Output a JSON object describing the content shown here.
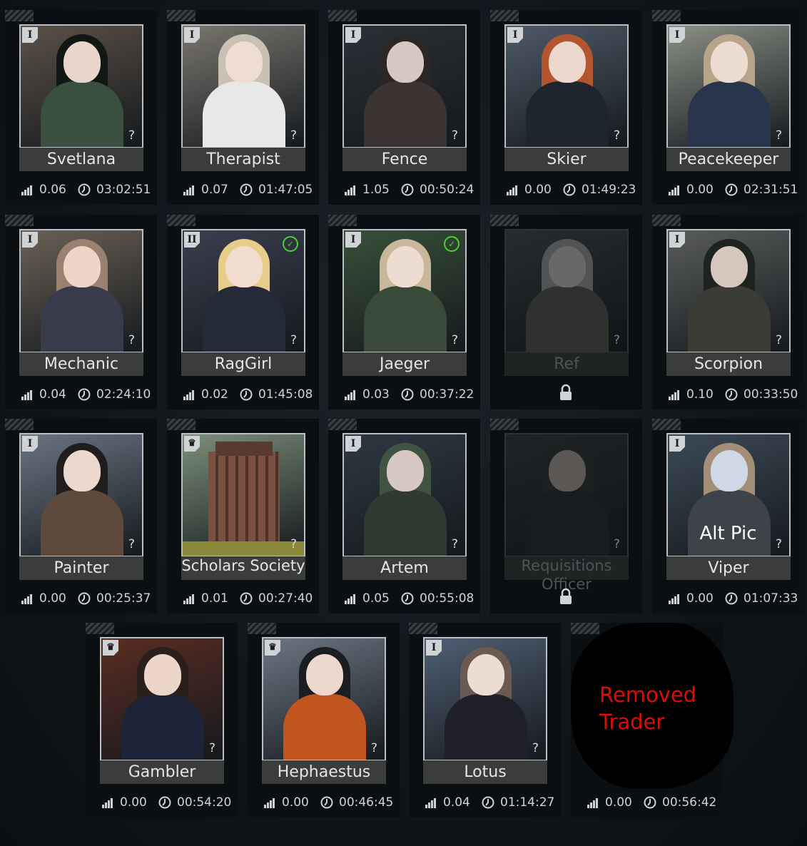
{
  "traders": [
    {
      "name": "Svetlana",
      "rank": "I",
      "rating": "0.06",
      "timer": "03:02:51",
      "theme": {
        "bg": "#5b5148",
        "hair": "#121614",
        "body": "#39503f",
        "skin": "#e8d6cc"
      },
      "locked": false,
      "checked": false
    },
    {
      "name": "Therapist",
      "rank": "I",
      "rating": "0.07",
      "timer": "01:47:05",
      "theme": {
        "bg": "#7a7670",
        "hair": "#c9c1b4",
        "body": "#e8e8e6",
        "skin": "#efdcd2"
      },
      "locked": false,
      "checked": false
    },
    {
      "name": "Fence",
      "rank": "I",
      "rating": "1.05",
      "timer": "00:50:24",
      "theme": {
        "bg": "#2a3036",
        "hair": "#2b2727",
        "body": "#3b3433",
        "skin": "#d8c8c2"
      },
      "locked": false,
      "checked": false
    },
    {
      "name": "Skier",
      "rank": "I",
      "rating": "0.00",
      "timer": "01:49:23",
      "theme": {
        "bg": "#4e5a68",
        "hair": "#b3552e",
        "body": "#1f252d",
        "skin": "#ecd8cd"
      },
      "locked": false,
      "checked": false
    },
    {
      "name": "Peacekeeper",
      "rank": "I",
      "rating": "0.00",
      "timer": "02:31:51",
      "theme": {
        "bg": "#8b8f86",
        "hair": "#b8a489",
        "body": "#28354d",
        "skin": "#ecdcd2"
      },
      "locked": false,
      "checked": false
    },
    {
      "name": "Mechanic",
      "rank": "I",
      "rating": "0.04",
      "timer": "02:24:10",
      "theme": {
        "bg": "#6a6156",
        "hair": "#9a8170",
        "body": "#373b4c",
        "skin": "#ecd6ca"
      },
      "locked": false,
      "checked": false
    },
    {
      "name": "RagGirl",
      "rank": "II",
      "rating": "0.02",
      "timer": "01:45:08",
      "theme": {
        "bg": "#3a3f4f",
        "hair": "#e8cc8a",
        "body": "#242a38",
        "skin": "#f1ddcf"
      },
      "locked": false,
      "checked": true
    },
    {
      "name": "Jaeger",
      "rank": "I",
      "rating": "0.03",
      "timer": "00:37:22",
      "theme": {
        "bg": "#39503a",
        "hair": "#c8b79b",
        "body": "#3a4a38",
        "skin": "#ecdcd2"
      },
      "locked": false,
      "checked": true
    },
    {
      "name": "Ref",
      "rank": "",
      "rating": "",
      "timer": "",
      "theme": {
        "bg": "#3e4448",
        "hair": "#8c8c8c",
        "body": "#4a4e44",
        "skin": "#b8b2ad"
      },
      "locked": true,
      "checked": false
    },
    {
      "name": "Scorpion",
      "rank": "I",
      "rating": "0.10",
      "timer": "00:33:50",
      "theme": {
        "bg": "#5a5c5b",
        "hair": "#1e2220",
        "body": "#3c3c36",
        "skin": "#d7c6bd"
      },
      "locked": false,
      "checked": false
    },
    {
      "name": "Painter",
      "rank": "I",
      "rating": "0.00",
      "timer": "00:25:37",
      "theme": {
        "bg": "#6a7583",
        "hair": "#1f1d1e",
        "body": "#5d4a3d",
        "skin": "#ecd8cd"
      },
      "locked": false,
      "checked": false
    },
    {
      "name": "Scholars Society",
      "rank": "crown",
      "rating": "0.01",
      "timer": "00:27:40",
      "theme": {
        "bg": "#7b8f7a",
        "hair": "",
        "body": "",
        "skin": ""
      },
      "locked": false,
      "checked": false,
      "scene": "building"
    },
    {
      "name": "Artem",
      "rank": "I",
      "rating": "0.05",
      "timer": "00:55:08",
      "theme": {
        "bg": "#2e3842",
        "hair": "#415444",
        "body": "#2f3a33",
        "skin": "#d8c8c2"
      },
      "locked": false,
      "checked": false
    },
    {
      "name": "Requisitions Officer",
      "rank": "",
      "rating": "",
      "timer": "",
      "theme": {
        "bg": "#30363d",
        "hair": "#2b2f2f",
        "body": "#22272a",
        "skin": "#9c948f"
      },
      "locked": true,
      "checked": false
    },
    {
      "name": "Viper",
      "rank": "I",
      "rating": "0.00",
      "timer": "01:07:33",
      "theme": {
        "bg": "#3c4a57",
        "hair": "#a38f77",
        "body": "#3d4348",
        "skin": "#cfd9e6"
      },
      "locked": false,
      "checked": false,
      "overlay": "Alt Pic"
    },
    {
      "name": "Gambler",
      "rank": "crown",
      "rating": "0.00",
      "timer": "00:54:20",
      "theme": {
        "bg": "#5a2c22",
        "hair": "#2a1f1b",
        "body": "#1e2437",
        "skin": "#ecd6ca"
      },
      "locked": false,
      "checked": false
    },
    {
      "name": "Hephaestus",
      "rank": "crown",
      "rating": "0.00",
      "timer": "00:46:45",
      "theme": {
        "bg": "#6c7684",
        "hair": "#1b1d21",
        "body": "#c2541f",
        "skin": "#ecd8cd"
      },
      "locked": false,
      "checked": false
    },
    {
      "name": "Lotus",
      "rank": "I",
      "rating": "0.04",
      "timer": "01:14:27",
      "theme": {
        "bg": "#4f5f73",
        "hair": "#6b5a52",
        "body": "#1f2029",
        "skin": "#ecdcd2"
      },
      "locked": false,
      "checked": false
    },
    {
      "name": "",
      "rank": "",
      "rating": "0.00",
      "timer": "00:56:42",
      "theme": {
        "bg": "#000000",
        "hair": "",
        "body": "",
        "skin": ""
      },
      "locked": false,
      "checked": false,
      "removed": "Removed Trader"
    }
  ],
  "icons": {
    "rating": "rating-bars-icon",
    "timer": "clock-icon",
    "lock": "padlock-icon",
    "check": "checkmark-icon",
    "question": "question-mark-icon",
    "crown": "crown-icon"
  },
  "glyphs": {
    "question": "?",
    "check": "✓",
    "crown": "♛"
  },
  "colors": {
    "removed": "#e00a0a",
    "check": "#49d12c",
    "namebar": "#3a3d3c"
  }
}
